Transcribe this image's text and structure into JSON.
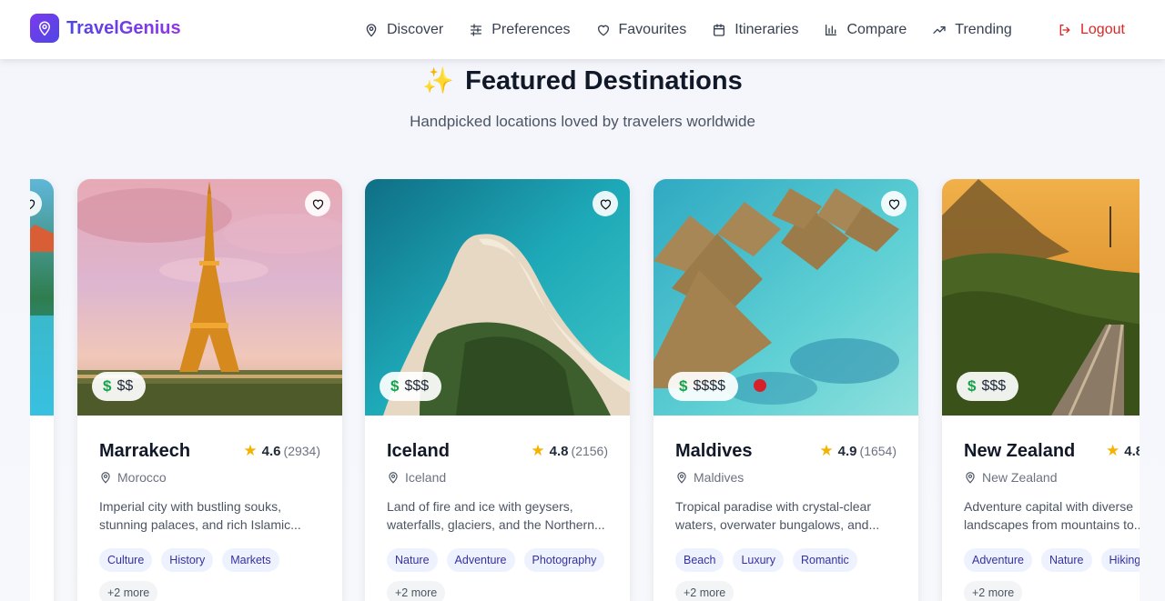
{
  "brand": {
    "name": "TravelGenius",
    "logo_icon": "map-pin-icon"
  },
  "nav": {
    "items": [
      {
        "label": "Discover",
        "icon": "map-pin-icon"
      },
      {
        "label": "Preferences",
        "icon": "sliders-icon"
      },
      {
        "label": "Favourites",
        "icon": "heart-icon"
      },
      {
        "label": "Itineraries",
        "icon": "calendar-icon"
      },
      {
        "label": "Compare",
        "icon": "bar-chart-icon"
      },
      {
        "label": "Trending",
        "icon": "trending-up-icon"
      }
    ],
    "logout_label": "Logout"
  },
  "colors": {
    "accent": "#5b3fd6",
    "logout": "#dc2626",
    "price_dollar": "#16a34a",
    "star": "#f5b301"
  },
  "section": {
    "title": "Featured Destinations",
    "subtitle": "Handpicked locations loved by travelers worldwide"
  },
  "cards": [
    {
      "name": "Marrakech",
      "rating": "4.6",
      "reviews": "(2934)",
      "location": "Morocco",
      "price": "$$",
      "description_lines": [
        "Imperial city with bustling souks,",
        "stunning palaces, and rich Islamic..."
      ],
      "tags": [
        "Culture",
        "History",
        "Markets"
      ],
      "more": "+2 more"
    },
    {
      "name": "Iceland",
      "rating": "4.8",
      "reviews": "(2156)",
      "location": "Iceland",
      "price": "$$$",
      "description_lines": [
        "Land of fire and ice with geysers,",
        "waterfalls, glaciers, and the Northern..."
      ],
      "tags": [
        "Nature",
        "Adventure",
        "Photography"
      ],
      "more": "+2 more"
    },
    {
      "name": "Maldives",
      "rating": "4.9",
      "reviews": "(1654)",
      "location": "Maldives",
      "price": "$$$$",
      "description_lines": [
        "Tropical paradise with crystal-clear",
        "waters, overwater bungalows, and..."
      ],
      "tags": [
        "Beach",
        "Luxury",
        "Romantic"
      ],
      "more": "+2 more"
    },
    {
      "name": "New Zealand",
      "rating": "4.8",
      "reviews": "",
      "location": "New Zealand",
      "price": "$$$",
      "description_lines": [
        "Adventure capital with diverse",
        "landscapes from mountains to..."
      ],
      "tags": [
        "Adventure",
        "Nature",
        "Hiking"
      ],
      "more": "+2 more"
    }
  ]
}
